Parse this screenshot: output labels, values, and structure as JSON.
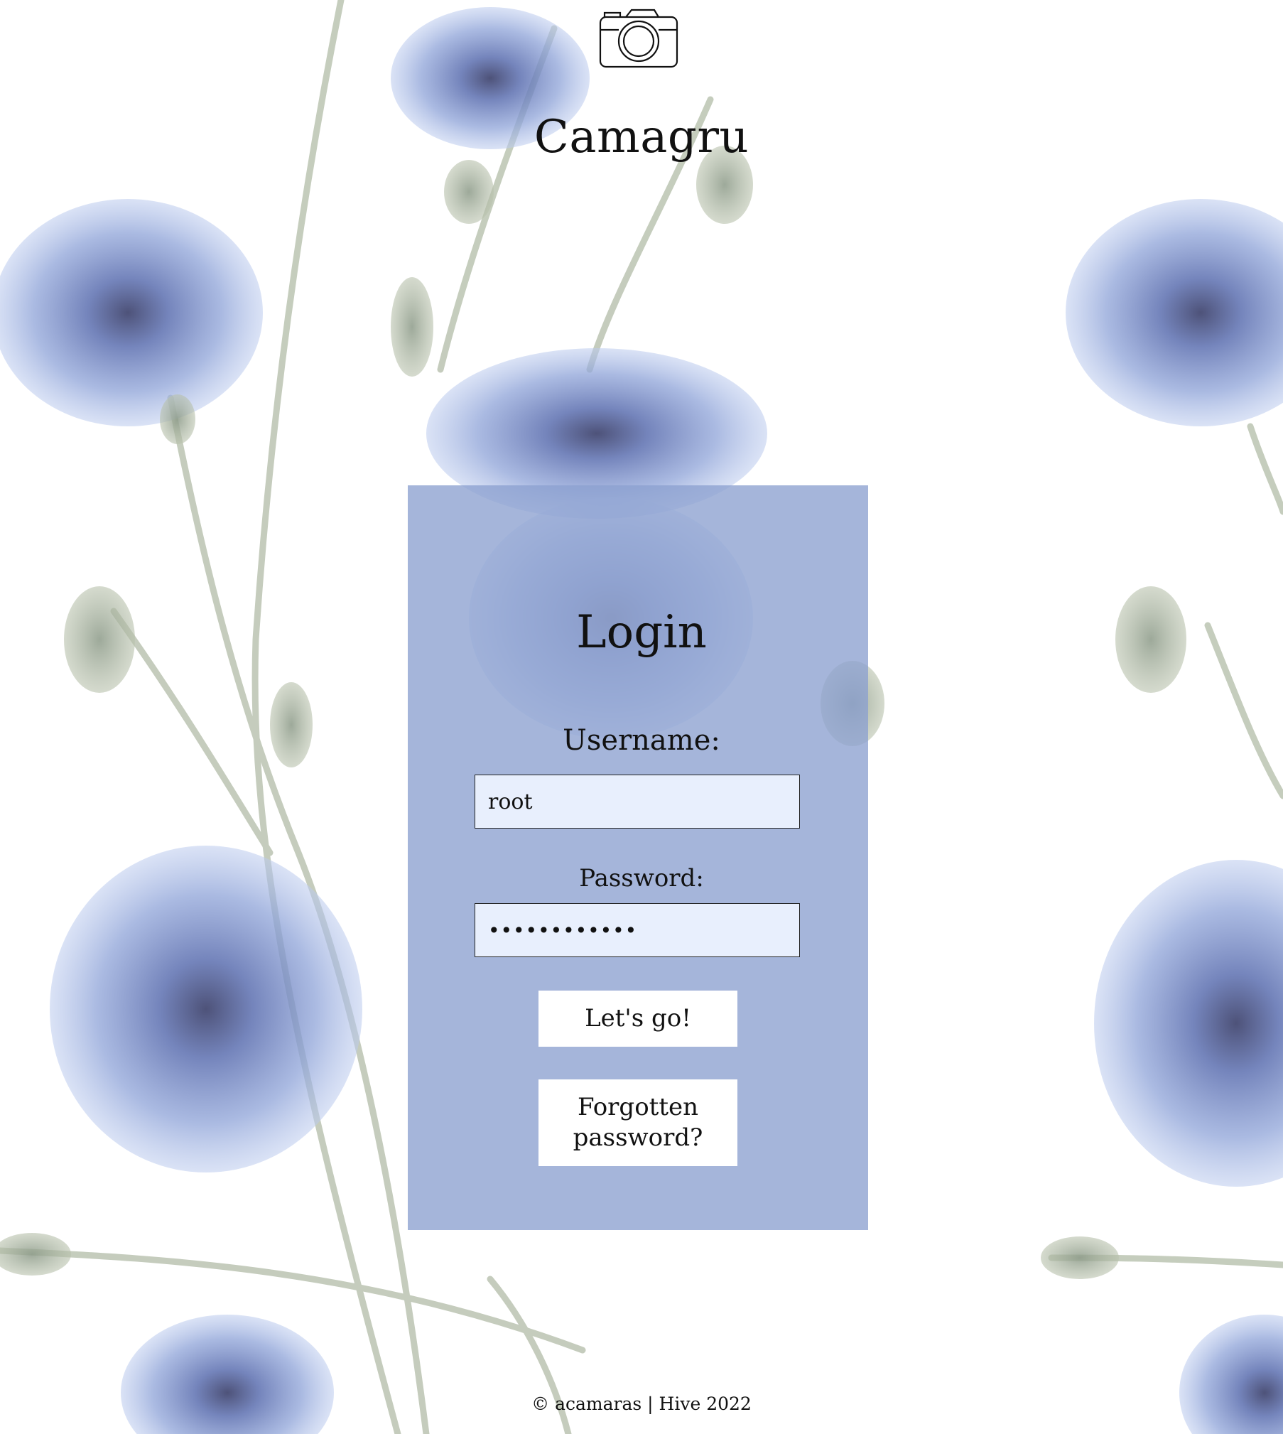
{
  "header": {
    "logo_icon": "camera-icon",
    "brand": "Camagru"
  },
  "login": {
    "title": "Login",
    "username_label": "Username:",
    "username_value": "root",
    "password_label": "Password:",
    "password_value": "••••••••••••",
    "submit_label": "Let's go!",
    "forgot_label": "Forgotten password?"
  },
  "footer": {
    "text": "© acamaras | Hive 2022"
  },
  "colors": {
    "card": "#a4b1d6",
    "input_bg": "#e8effd",
    "flower_blue": "#6f86c7",
    "stem_green": "#9fae9a"
  }
}
